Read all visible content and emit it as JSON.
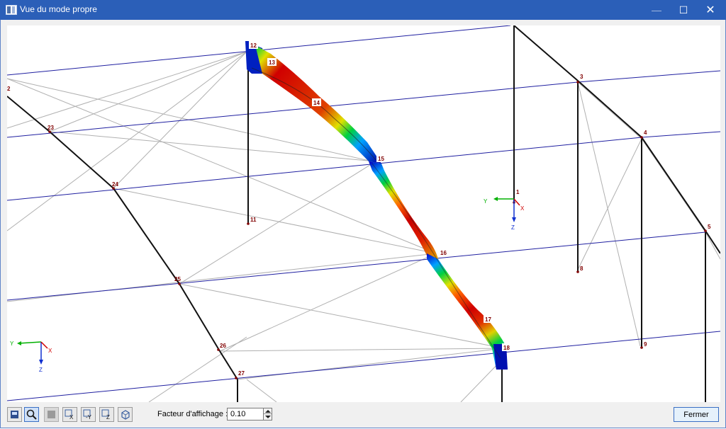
{
  "window": {
    "title": "Vue du mode propre",
    "minimize_glyph": "—",
    "maximize_glyph": "☐",
    "close_glyph": "✕"
  },
  "viewport": {
    "node_labels": [
      "1",
      "2",
      "3",
      "4",
      "5",
      "8",
      "9",
      "11",
      "12",
      "13",
      "14",
      "15",
      "16",
      "17",
      "18",
      "23",
      "24",
      "25",
      "26",
      "27"
    ],
    "axes_main": {
      "y": "Y",
      "z": "Z",
      "x": "X"
    },
    "axes_corner": {
      "y": "Y",
      "z": "Z",
      "x": "X"
    }
  },
  "toolbar": {
    "icons": [
      "print-icon",
      "zoom-icon",
      "render-mode-icon",
      "view-x-icon",
      "view-minus-y-icon",
      "view-z-icon",
      "view-iso-icon"
    ],
    "view_labels": {
      "x": "X",
      "y": "-Y",
      "z": "Z"
    }
  },
  "factor": {
    "label": "Facteur d'affichage :",
    "value": "0.10"
  },
  "buttons": {
    "close": "Fermer"
  },
  "colors": {
    "titlebar": "#2b5fb8",
    "frame_line_blue": "#1f1fa0",
    "deformed_gradient": [
      "#0000c8",
      "#00a0ff",
      "#00d040",
      "#e0e000",
      "#ff8000",
      "#d00000"
    ]
  }
}
